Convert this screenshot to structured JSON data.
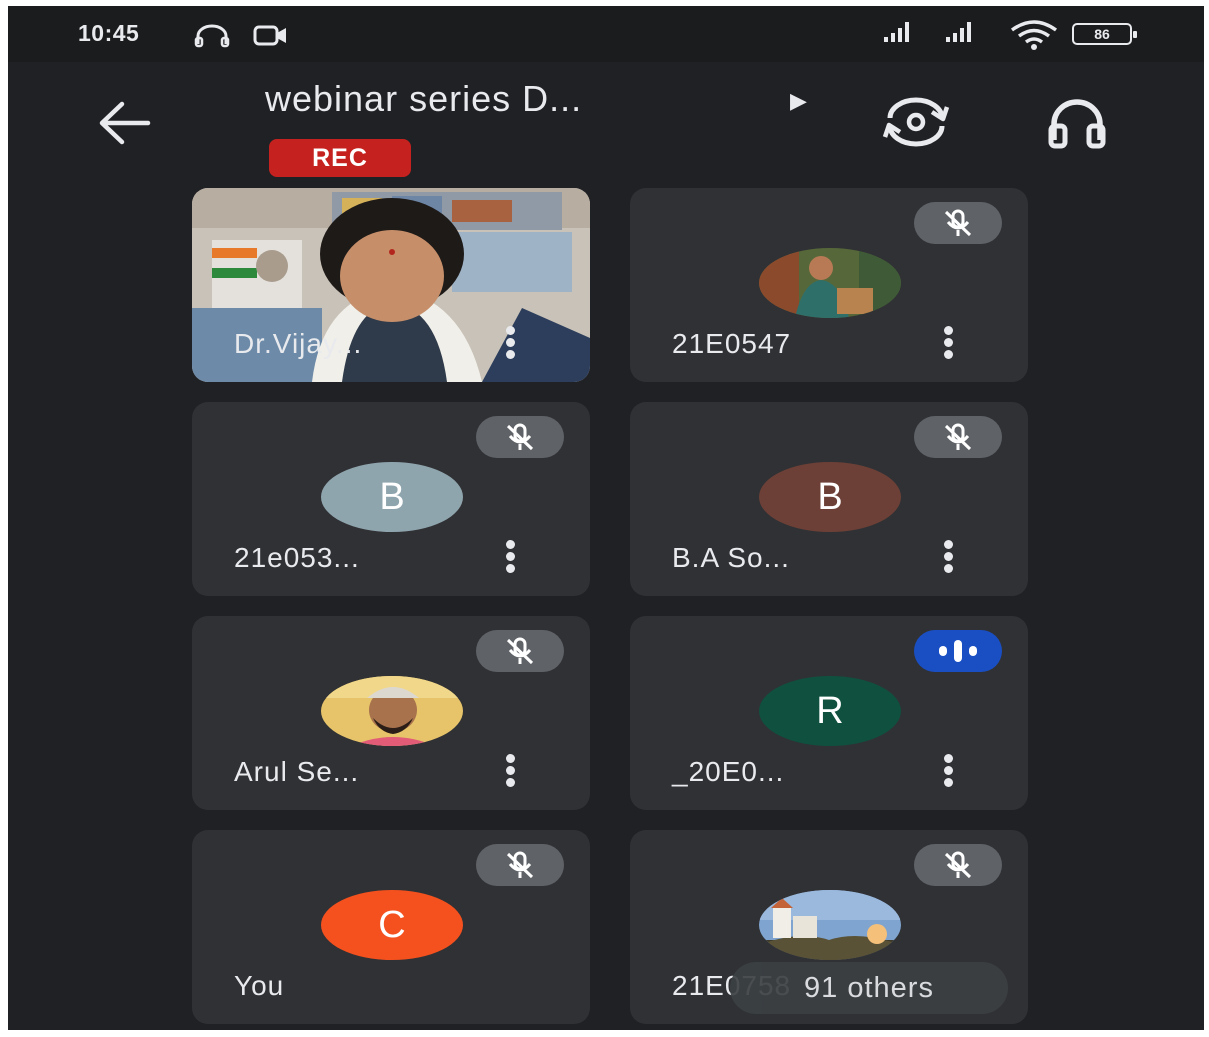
{
  "status_bar": {
    "time": "10:45",
    "battery": "86",
    "icons": [
      "headset-icon",
      "video-camera-icon",
      "signal-icon",
      "signal-icon",
      "wifi-icon",
      "battery-icon"
    ]
  },
  "header": {
    "title": "webinar series D...",
    "recording_badge": "REC",
    "icons": [
      "back-arrow-icon",
      "play-arrow-icon",
      "switch-camera-icon",
      "headphones-icon"
    ]
  },
  "participants": [
    {
      "name": "Dr.Vijay...",
      "kind": "video",
      "mic": "none"
    },
    {
      "name": "21E0547",
      "kind": "photo",
      "mic": "muted"
    },
    {
      "name": "21e053...",
      "kind": "letter",
      "initial": "B",
      "color": "#8fa5ae",
      "mic": "muted"
    },
    {
      "name": "B.A So...",
      "kind": "letter",
      "initial": "B",
      "color": "#6d4037",
      "mic": "muted"
    },
    {
      "name": "Arul Se...",
      "kind": "photo",
      "mic": "muted"
    },
    {
      "name": "_20E0...",
      "kind": "letter",
      "initial": "R",
      "color": "#10503e",
      "mic": "speaking"
    },
    {
      "name": "You",
      "kind": "letter",
      "initial": "C",
      "color": "#f4511e",
      "mic": "muted"
    },
    {
      "name": "21E0758",
      "kind": "photo",
      "mic": "muted"
    }
  ],
  "others_button": "91 others",
  "colors": {
    "background": "#202124",
    "tile": "#303134",
    "rec": "#c5221f",
    "mute_badge": "#5f6368",
    "speaking_badge": "#1a4fc4"
  }
}
